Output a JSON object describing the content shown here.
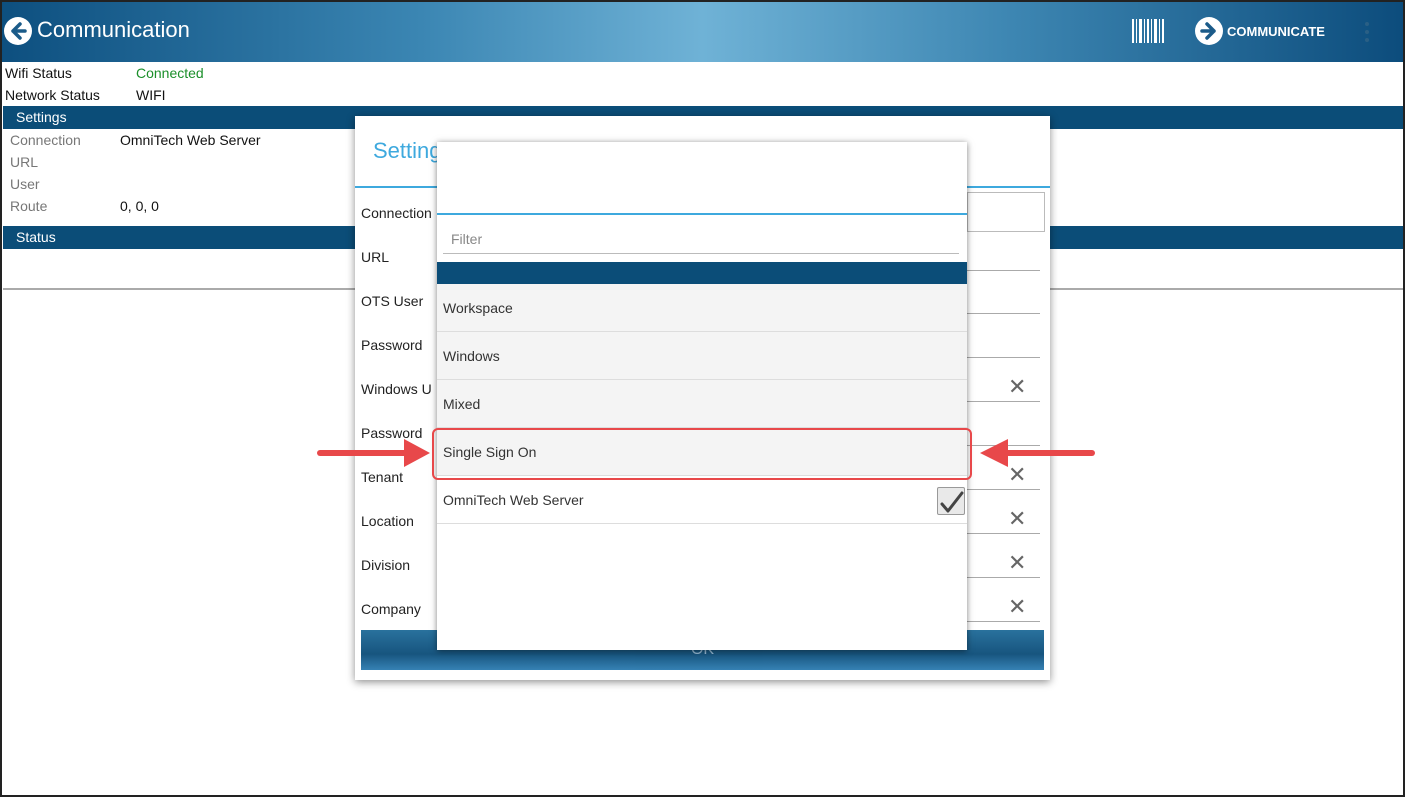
{
  "header": {
    "title": "Communication",
    "communicate_label": "COMMUNICATE"
  },
  "status_info": {
    "wifi_label": "Wifi Status",
    "wifi_value": "Connected",
    "network_label": "Network Status",
    "network_value": "WIFI"
  },
  "settings_section": {
    "title": "Settings",
    "rows": [
      {
        "label": "Connection",
        "value": "OmniTech Web Server"
      },
      {
        "label": "URL",
        "value": ""
      },
      {
        "label": "User",
        "value": ""
      },
      {
        "label": "Route",
        "value": "0, 0, 0"
      }
    ]
  },
  "status_section": {
    "title": "Status"
  },
  "dialog": {
    "title": "Setting",
    "fields": [
      "Connection",
      "URL",
      "OTS User",
      "Password",
      "Windows U",
      "Password",
      "Tenant",
      "Location",
      "Division",
      "Company"
    ],
    "ok_label": "OK"
  },
  "dropdown": {
    "filter_placeholder": "Filter",
    "options": [
      {
        "label": "Workspace",
        "checked": false
      },
      {
        "label": "Windows",
        "checked": false
      },
      {
        "label": "Mixed",
        "checked": false
      },
      {
        "label": "Single Sign On",
        "checked": false,
        "highlighted": true
      },
      {
        "label": "OmniTech Web Server",
        "checked": true
      }
    ]
  },
  "colors": {
    "header_dark": "#0b4d78",
    "accent_blue": "#3ea9de",
    "connected_green": "#1b8f2a",
    "annotation_red": "#e8484a"
  }
}
